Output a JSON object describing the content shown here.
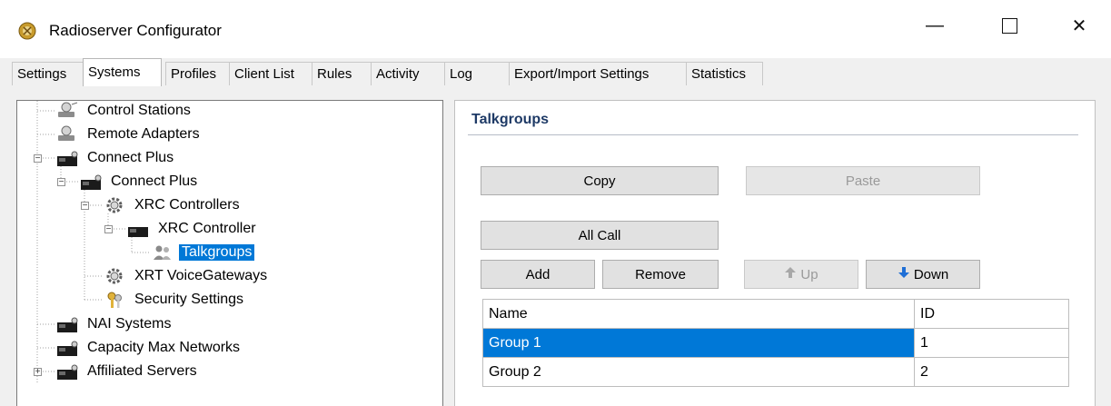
{
  "window": {
    "title": "Radioserver Configurator",
    "minimize_glyph": "—",
    "close_glyph": "✕"
  },
  "tabs": [
    {
      "label": "Settings"
    },
    {
      "label": "Systems"
    },
    {
      "label": "Profiles"
    },
    {
      "label": "Client List"
    },
    {
      "label": "Rules"
    },
    {
      "label": "Activity"
    },
    {
      "label": "Log"
    },
    {
      "label": "Export/Import Settings"
    },
    {
      "label": "Statistics"
    }
  ],
  "active_tab": "Systems",
  "tree": {
    "nodes": [
      {
        "label": "Control Stations",
        "icon": "control-stations-icon"
      },
      {
        "label": "Remote Adapters",
        "icon": "remote-adapters-icon"
      },
      {
        "label": "Connect Plus",
        "icon": "system-folder-icon"
      },
      {
        "label": "Connect Plus",
        "icon": "system-folder-icon"
      },
      {
        "label": "XRC Controllers",
        "icon": "gear-icon"
      },
      {
        "label": "XRC Controller",
        "icon": "system-folder-icon"
      },
      {
        "label": "Talkgroups",
        "icon": "talkgroups-icon"
      },
      {
        "label": "XRT VoiceGateways",
        "icon": "gear-icon"
      },
      {
        "label": "Security Settings",
        "icon": "keys-icon"
      },
      {
        "label": "NAI Systems",
        "icon": "system-folder-icon"
      },
      {
        "label": "Capacity Max Networks",
        "icon": "system-folder-icon"
      },
      {
        "label": "Affiliated Servers",
        "icon": "system-folder-icon"
      }
    ],
    "selected": "Talkgroups"
  },
  "panel": {
    "title": "Talkgroups",
    "buttons": {
      "copy": "Copy",
      "paste": "Paste",
      "all_call": "All Call",
      "add": "Add",
      "remove": "Remove",
      "up": "Up",
      "down": "Down"
    },
    "table": {
      "columns": [
        "Name",
        "ID"
      ],
      "rows": [
        {
          "name": "Group 1",
          "id": "1"
        },
        {
          "name": "Group 2",
          "id": "2"
        }
      ],
      "selected_row": "Group 1"
    }
  },
  "colors": {
    "selection": "#0078d7",
    "section_title": "#1e3a66",
    "down_arrow": "#1f6fd6",
    "up_arrow_disabled": "#a8a8a8"
  }
}
